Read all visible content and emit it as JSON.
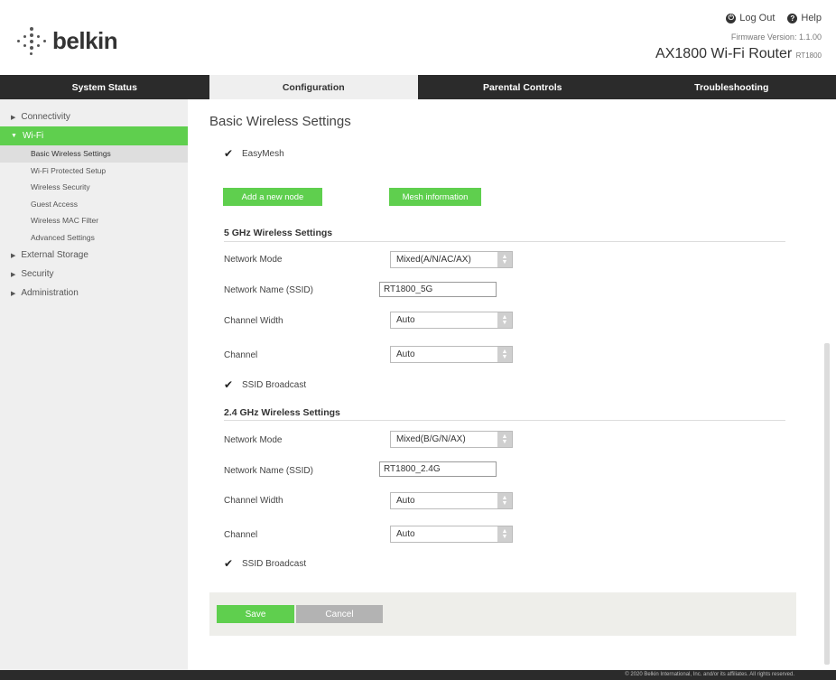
{
  "brand": {
    "name": "belkin"
  },
  "header": {
    "logout_label": "Log Out",
    "help_label": "Help",
    "firmware_label": "Firmware Version:",
    "firmware_value": "1.1.00",
    "model": "AX1800 Wi-Fi Router",
    "model_code": "RT1800"
  },
  "tabs": [
    {
      "label": "System Status"
    },
    {
      "label": "Configuration"
    },
    {
      "label": "Parental Controls"
    },
    {
      "label": "Troubleshooting"
    }
  ],
  "sidebar": {
    "items": [
      {
        "label": "Connectivity"
      },
      {
        "label": "Wi-Fi"
      },
      {
        "label": "External Storage"
      },
      {
        "label": "Security"
      },
      {
        "label": "Administration"
      }
    ],
    "wifi_sub": [
      {
        "label": "Basic Wireless Settings"
      },
      {
        "label": "Wi-Fi Protected Setup"
      },
      {
        "label": "Wireless Security"
      },
      {
        "label": "Guest Access"
      },
      {
        "label": "Wireless MAC Filter"
      },
      {
        "label": "Advanced Settings"
      }
    ]
  },
  "main": {
    "title": "Basic Wireless Settings",
    "easymesh_label": "EasyMesh",
    "add_node_label": "Add a new node",
    "mesh_info_label": "Mesh information",
    "band5": {
      "title": "5 GHz Wireless Settings",
      "network_mode_label": "Network Mode",
      "network_mode_value": "Mixed(A/N/AC/AX)",
      "ssid_label": "Network Name (SSID)",
      "ssid_value": "RT1800_5G",
      "channel_width_label": "Channel Width",
      "channel_width_value": "Auto",
      "channel_label": "Channel",
      "channel_value": "Auto",
      "broadcast_label": "SSID Broadcast"
    },
    "band24": {
      "title": "2.4 GHz Wireless Settings",
      "network_mode_label": "Network Mode",
      "network_mode_value": "Mixed(B/G/N/AX)",
      "ssid_label": "Network Name (SSID)",
      "ssid_value": "RT1800_2.4G",
      "channel_width_label": "Channel Width",
      "channel_width_value": "Auto",
      "channel_label": "Channel",
      "channel_value": "Auto",
      "broadcast_label": "SSID Broadcast"
    },
    "save_label": "Save",
    "cancel_label": "Cancel"
  },
  "footer": {
    "text": "© 2020 Belkin International, Inc. and/or its affiliates. All rights reserved."
  },
  "colors": {
    "accent": "#5fcf4e",
    "tabbar": "#2b2b2b",
    "sidebar": "#efefef"
  }
}
